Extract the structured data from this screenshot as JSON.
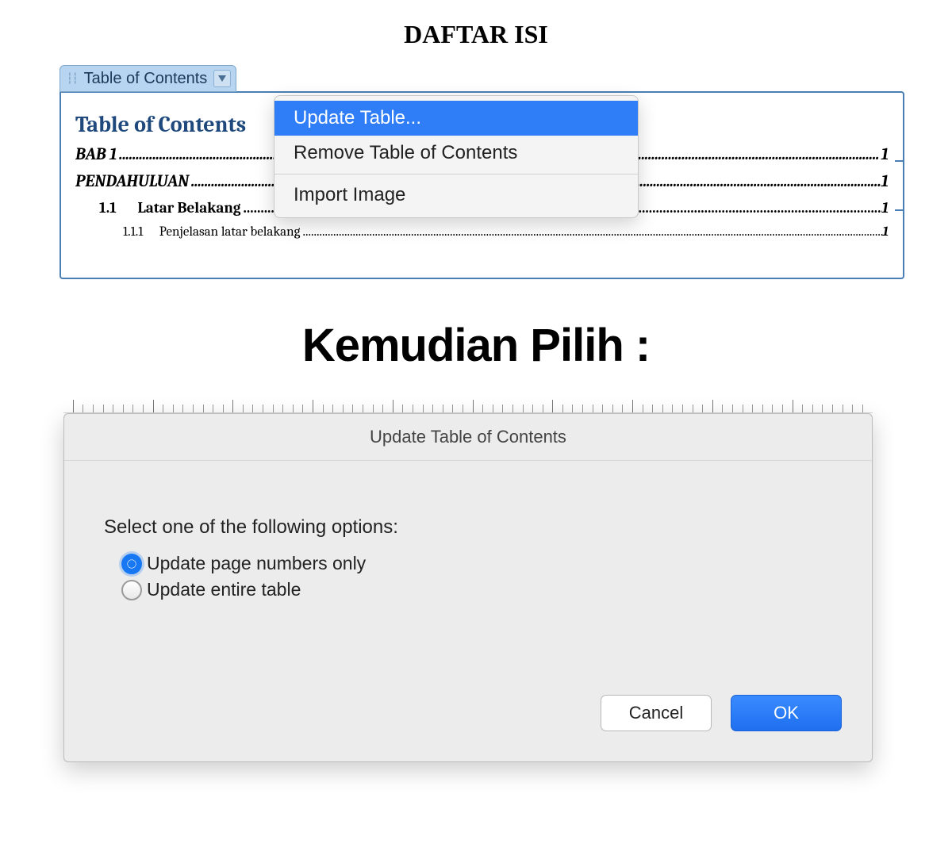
{
  "page": {
    "title": "DAFTAR ISI"
  },
  "toc_widget": {
    "tab_label": "Table of Contents",
    "heading": "Table of Contents",
    "entries": [
      {
        "label": "BAB 1",
        "page": "1",
        "level": 0
      },
      {
        "label": "PENDAHULUAN",
        "page": "1",
        "level": 0
      },
      {
        "num": "1.1",
        "label": "Latar Belakang",
        "page": "1",
        "level": 1
      },
      {
        "num": "1.1.1",
        "label": "Penjelasan latar belakang",
        "page": "1",
        "level": 2
      }
    ]
  },
  "context_menu": {
    "items": [
      {
        "label": "Update Table...",
        "highlight": true
      },
      {
        "label": "Remove Table of Contents",
        "highlight": false
      }
    ],
    "secondary": [
      {
        "label": "Import Image"
      }
    ]
  },
  "interlude_text": "Kemudian Pilih :",
  "dialog": {
    "title": "Update Table of Contents",
    "prompt": "Select one of the following options:",
    "options": [
      {
        "label": "Update page numbers only",
        "selected": true
      },
      {
        "label": "Update entire table",
        "selected": false
      }
    ],
    "buttons": {
      "cancel": "Cancel",
      "ok": "OK"
    }
  }
}
